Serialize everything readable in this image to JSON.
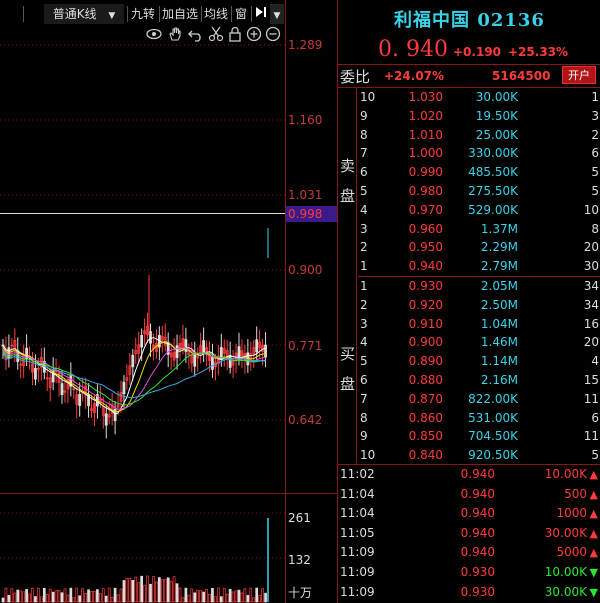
{
  "toolbar": {
    "kline_type": "普通K线",
    "nine_turn": "九转",
    "add_watch": "加自选",
    "ma_line": "均线",
    "window": "窗"
  },
  "price_axis": {
    "labels": [
      "1.289",
      "1.160",
      "1.031",
      "0.900",
      "0.771",
      "0.642"
    ],
    "current": "0.998"
  },
  "volume_axis": {
    "labels": [
      "261",
      "132",
      "十万"
    ]
  },
  "quote": {
    "name": "利福中国 02136",
    "last": "0. 940",
    "change": "+0.190",
    "change_pct": "+25.33%",
    "webi_label": "委比",
    "webi_pct": "+24.07%",
    "webi_diff": "5164500",
    "open_account": "开户"
  },
  "side_labels": {
    "sell": [
      "卖",
      "盘"
    ],
    "buy": [
      "买",
      "盘"
    ]
  },
  "sell_levels": [
    {
      "lvl": "10",
      "price": "1.030",
      "vol": "30.00K",
      "cnt": "1"
    },
    {
      "lvl": "9",
      "price": "1.020",
      "vol": "19.50K",
      "cnt": "3"
    },
    {
      "lvl": "8",
      "price": "1.010",
      "vol": "25.00K",
      "cnt": "2"
    },
    {
      "lvl": "7",
      "price": "1.000",
      "vol": "330.00K",
      "cnt": "6"
    },
    {
      "lvl": "6",
      "price": "0.990",
      "vol": "485.50K",
      "cnt": "5"
    },
    {
      "lvl": "5",
      "price": "0.980",
      "vol": "275.50K",
      "cnt": "5"
    },
    {
      "lvl": "4",
      "price": "0.970",
      "vol": "529.00K",
      "cnt": "10"
    },
    {
      "lvl": "3",
      "price": "0.960",
      "vol": "1.37M",
      "cnt": "8"
    },
    {
      "lvl": "2",
      "price": "0.950",
      "vol": "2.29M",
      "cnt": "20"
    },
    {
      "lvl": "1",
      "price": "0.940",
      "vol": "2.79M",
      "cnt": "30"
    }
  ],
  "buy_levels": [
    {
      "lvl": "1",
      "price": "0.930",
      "vol": "2.05M",
      "cnt": "34"
    },
    {
      "lvl": "2",
      "price": "0.920",
      "vol": "2.50M",
      "cnt": "34"
    },
    {
      "lvl": "3",
      "price": "0.910",
      "vol": "1.04M",
      "cnt": "16"
    },
    {
      "lvl": "4",
      "price": "0.900",
      "vol": "1.46M",
      "cnt": "20"
    },
    {
      "lvl": "5",
      "price": "0.890",
      "vol": "1.14M",
      "cnt": "4"
    },
    {
      "lvl": "6",
      "price": "0.880",
      "vol": "2.16M",
      "cnt": "15"
    },
    {
      "lvl": "7",
      "price": "0.870",
      "vol": "822.00K",
      "cnt": "11"
    },
    {
      "lvl": "8",
      "price": "0.860",
      "vol": "531.00K",
      "cnt": "6"
    },
    {
      "lvl": "9",
      "price": "0.850",
      "vol": "704.50K",
      "cnt": "11"
    },
    {
      "lvl": "10",
      "price": "0.840",
      "vol": "920.50K",
      "cnt": "5"
    }
  ],
  "trades": [
    {
      "time": "11:02",
      "price": "0.940",
      "vol": "10.00K",
      "dir": "up"
    },
    {
      "time": "11:04",
      "price": "0.940",
      "vol": "500",
      "dir": "up"
    },
    {
      "time": "11:04",
      "price": "0.940",
      "vol": "1000",
      "dir": "up"
    },
    {
      "time": "11:05",
      "price": "0.940",
      "vol": "30.00K",
      "dir": "up"
    },
    {
      "time": "11:09",
      "price": "0.940",
      "vol": "5000",
      "dir": "up"
    },
    {
      "time": "11:09",
      "price": "0.930",
      "vol": "10.00K",
      "dir": "down"
    },
    {
      "time": "11:09",
      "price": "0.930",
      "vol": "30.00K",
      "dir": "down"
    }
  ],
  "colors": {
    "up": "#ff3b3b",
    "down": "#2ee62e",
    "cyan": "#38d3e8",
    "axis": "#8a1515"
  },
  "icons": [
    "eye-icon",
    "hand-icon",
    "undo-icon",
    "scissors-icon",
    "lock-icon",
    "zoom-in-icon",
    "zoom-out-icon"
  ]
}
